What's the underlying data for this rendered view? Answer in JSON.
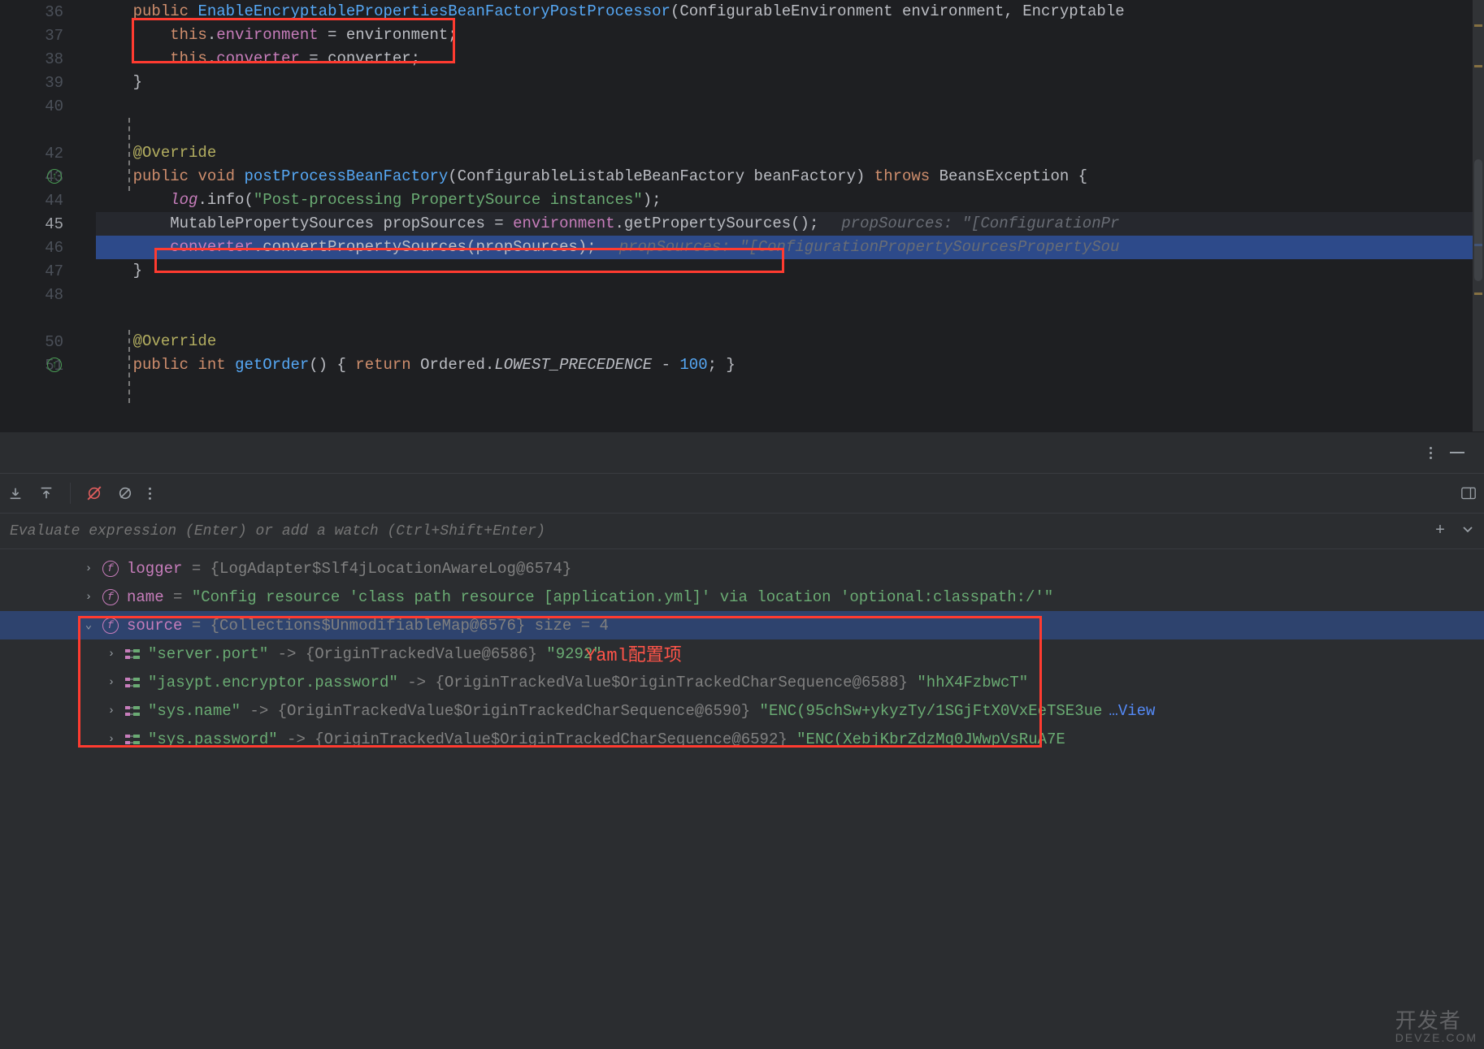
{
  "editor": {
    "lines": [
      {
        "n": 36,
        "tokens": [
          {
            "t": "    ",
            "c": ""
          },
          {
            "t": "public",
            "c": "k-public"
          },
          {
            "t": " ",
            "c": ""
          },
          {
            "t": "EnableEncryptablePropertiesBeanFactoryPostProcessor",
            "c": "methoddecl"
          },
          {
            "t": "(ConfigurableEnvironment environment, Encryptable",
            "c": "param"
          }
        ]
      },
      {
        "n": 37,
        "tokens": [
          {
            "t": "        ",
            "c": ""
          },
          {
            "t": "this",
            "c": "k-this"
          },
          {
            "t": ".",
            "c": ""
          },
          {
            "t": "environment",
            "c": "field"
          },
          {
            "t": " = environment;",
            "c": ""
          }
        ]
      },
      {
        "n": 38,
        "tokens": [
          {
            "t": "        ",
            "c": ""
          },
          {
            "t": "this",
            "c": "k-this"
          },
          {
            "t": ".",
            "c": ""
          },
          {
            "t": "converter",
            "c": "field"
          },
          {
            "t": " = converter;",
            "c": ""
          }
        ]
      },
      {
        "n": 39,
        "tokens": [
          {
            "t": "    }",
            "c": ""
          }
        ]
      },
      {
        "n": 40,
        "tokens": [
          {
            "t": "",
            "c": ""
          }
        ]
      },
      {
        "n": "",
        "tokens": [
          {
            "t": "",
            "c": ""
          }
        ]
      },
      {
        "n": 42,
        "tokens": [
          {
            "t": "    ",
            "c": ""
          },
          {
            "t": "@Override",
            "c": "ann"
          }
        ]
      },
      {
        "n": 43,
        "override": true,
        "tokens": [
          {
            "t": "    ",
            "c": ""
          },
          {
            "t": "public",
            "c": "k-public"
          },
          {
            "t": " ",
            "c": ""
          },
          {
            "t": "void",
            "c": "k-void"
          },
          {
            "t": " ",
            "c": ""
          },
          {
            "t": "postProcessBeanFactory",
            "c": "methoddecl"
          },
          {
            "t": "(ConfigurableListableBeanFactory beanFactory) ",
            "c": "param"
          },
          {
            "t": "throws",
            "c": "k-throws"
          },
          {
            "t": " BeansException {",
            "c": ""
          }
        ],
        "inlineHint": ""
      },
      {
        "n": 44,
        "tokens": [
          {
            "t": "        ",
            "c": ""
          },
          {
            "t": "log",
            "c": "italic-static"
          },
          {
            "t": ".info(",
            "c": ""
          },
          {
            "t": "\"Post-processing PropertySource instances\"",
            "c": "str"
          },
          {
            "t": ");",
            "c": ""
          }
        ]
      },
      {
        "n": 45,
        "current": true,
        "tokens": [
          {
            "t": "        MutablePropertySources propSources = ",
            "c": ""
          },
          {
            "t": "environment",
            "c": "field"
          },
          {
            "t": ".getPropertySources();",
            "c": ""
          }
        ],
        "inlineHint": "propSources: \"[ConfigurationPr"
      },
      {
        "n": 46,
        "exec": true,
        "tokens": [
          {
            "t": "        ",
            "c": ""
          },
          {
            "t": "converter",
            "c": "field"
          },
          {
            "t": ".convertPropertySources(propSources);",
            "c": ""
          }
        ],
        "inlineHint": "propSources: \"[ConfigurationPropertySourcesPropertySou"
      },
      {
        "n": 47,
        "tokens": [
          {
            "t": "    }",
            "c": ""
          }
        ]
      },
      {
        "n": 48,
        "tokens": [
          {
            "t": "",
            "c": ""
          }
        ]
      },
      {
        "n": "",
        "tokens": [
          {
            "t": "",
            "c": ""
          }
        ]
      },
      {
        "n": 50,
        "tokens": [
          {
            "t": "    ",
            "c": ""
          },
          {
            "t": "@Override",
            "c": "ann"
          }
        ]
      },
      {
        "n": 51,
        "override": true,
        "tokens": [
          {
            "t": "    ",
            "c": ""
          },
          {
            "t": "public",
            "c": "k-public"
          },
          {
            "t": " ",
            "c": ""
          },
          {
            "t": "int",
            "c": "k-int"
          },
          {
            "t": " ",
            "c": ""
          },
          {
            "t": "getOrder",
            "c": "methoddecl"
          },
          {
            "t": "() { ",
            "c": ""
          },
          {
            "t": "return",
            "c": "k-return"
          },
          {
            "t": " Ordered.",
            "c": ""
          },
          {
            "t": "LOWEST_PRECEDENCE",
            "c": "italic-const"
          },
          {
            "t": " - ",
            "c": ""
          },
          {
            "t": "100",
            "c": "method"
          },
          {
            "t": "; }",
            "c": ""
          }
        ]
      }
    ]
  },
  "eval": {
    "placeholder": "Evaluate expression (Enter) or add a watch (Ctrl+Shift+Enter)"
  },
  "vars": [
    {
      "chev": "›",
      "badge": "f",
      "name": "logger",
      "eq": " = ",
      "dim": "{LogAdapter$Slf4jLocationAwareLog@6574}"
    },
    {
      "chev": "›",
      "badge": "f",
      "name": "name",
      "eq": " = ",
      "str": "\"Config resource 'class path resource [application.yml]' via location 'optional:classpath:/'\""
    },
    {
      "chev": "⌄",
      "badge": "f",
      "name": "source",
      "eq": " = ",
      "dim": "{Collections$UnmodifiableMap@6576}",
      "dim2": "  size = 4",
      "sel": true
    },
    {
      "lvl": 2,
      "chev": "›",
      "badge": "map",
      "str": "\"server.port\"",
      "dim": " -> {OriginTrackedValue@6586} ",
      "str2": "\"9292\""
    },
    {
      "lvl": 2,
      "chev": "›",
      "badge": "map",
      "str": "\"jasypt.encryptor.password\"",
      "dim": " -> {OriginTrackedValue$OriginTrackedCharSequence@6588} ",
      "str2": "\"hhX4FzbwcT\""
    },
    {
      "lvl": 2,
      "chev": "›",
      "badge": "map",
      "str": "\"sys.name\"",
      "dim": " -> {OriginTrackedValue$OriginTrackedCharSequence@6590} ",
      "str2": "\"ENC(95chSw+ykyzTy/1SGjFtX0VxEeTSE3ue",
      "view": "…View"
    },
    {
      "lvl": 2,
      "chev": "›",
      "badge": "map",
      "str": "\"sys.password\"",
      "dim": " -> {OriginTrackedValue$OriginTrackedCharSequence@6592} ",
      "str2": "\"ENC(XebjKbrZdzMq0JWwpVsRuA7E"
    }
  ],
  "annotation": "Yaml配置项",
  "watermark": {
    "main": "开发者",
    "sub": "DEVZE.COM"
  }
}
